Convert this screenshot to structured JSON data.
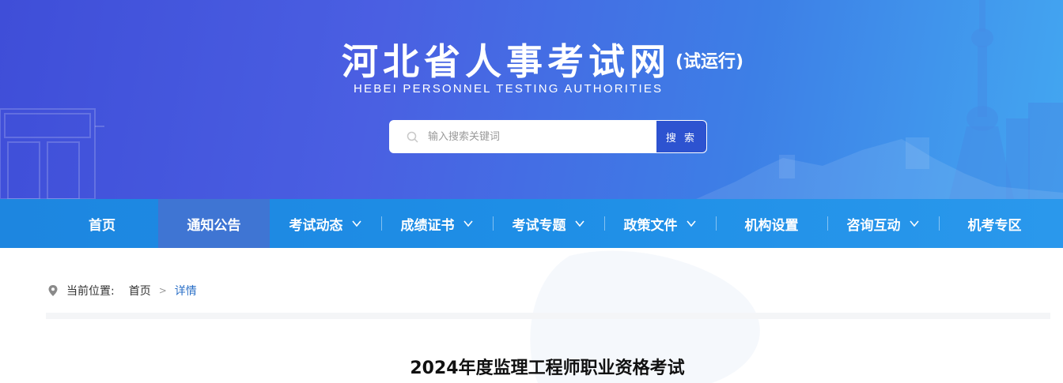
{
  "header": {
    "title": "河北省人事考试网",
    "title_suffix": "(试运行)",
    "subtitle": "HEBEI PERSONNEL TESTING AUTHORITIES"
  },
  "search": {
    "placeholder": "输入搜索关键词",
    "button_label": "搜 索"
  },
  "nav": {
    "items": [
      {
        "label": "首页",
        "dropdown": false
      },
      {
        "label": "通知公告",
        "dropdown": false,
        "active": true
      },
      {
        "label": "考试动态",
        "dropdown": true
      },
      {
        "label": "成绩证书",
        "dropdown": true
      },
      {
        "label": "考试专题",
        "dropdown": true
      },
      {
        "label": "政策文件",
        "dropdown": true
      },
      {
        "label": "机构设置",
        "dropdown": false
      },
      {
        "label": "咨询互动",
        "dropdown": true
      },
      {
        "label": "机考专区",
        "dropdown": false
      }
    ]
  },
  "breadcrumb": {
    "label": "当前位置:",
    "home": "首页",
    "separator": ">",
    "current": "详情"
  },
  "article": {
    "title": "2024年度监理工程师职业资格考试"
  },
  "colors": {
    "banner_start": "#3f4ed8",
    "banner_end": "#43a7f1",
    "nav_bg": "#1e8ee6",
    "nav_active": "#3f75d3",
    "search_button": "#2d53d0",
    "breadcrumb_current": "#2a6fc7"
  }
}
